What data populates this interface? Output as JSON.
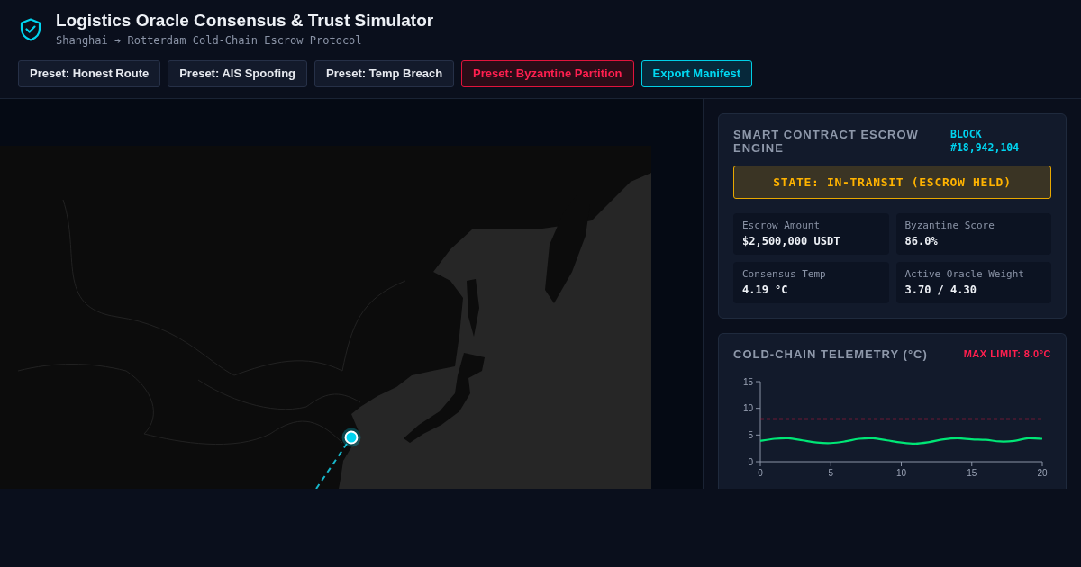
{
  "header": {
    "title": "Logistics Oracle Consensus & Trust Simulator",
    "subtitle": "Shanghai ➔ Rotterdam Cold-Chain Escrow Protocol"
  },
  "toolbar": {
    "buttons": [
      {
        "label": "Preset: Honest Route",
        "kind": "preset"
      },
      {
        "label": "Preset: AIS Spoofing",
        "kind": "preset"
      },
      {
        "label": "Preset: Temp Breach",
        "kind": "preset"
      },
      {
        "label": "Preset: Byzantine Partition",
        "kind": "danger"
      },
      {
        "label": "Export Manifest",
        "kind": "export"
      }
    ]
  },
  "escrow_panel": {
    "title": "SMART CONTRACT ESCROW ENGINE",
    "block": "BLOCK #18,942,104",
    "state": {
      "label": "STATE: IN-TRANSIT (ESCROW HELD)",
      "kind": "held"
    },
    "metrics": [
      {
        "label": "Escrow Amount",
        "value": "$2,500,000 USDT"
      },
      {
        "label": "Byzantine Score",
        "value": "86.0%"
      },
      {
        "label": "Consensus Temp",
        "value": "4.19 °C"
      },
      {
        "label": "Active Oracle Weight",
        "value": "3.70 / 4.30"
      }
    ]
  },
  "telemetry_panel": {
    "title": "COLD-CHAIN TELEMETRY (°C)",
    "limit_label": "MAX LIMIT: 8.0°C",
    "chart_data": {
      "type": "line",
      "x": [
        0,
        1,
        2,
        3,
        4,
        5,
        6,
        7,
        8,
        9,
        10,
        11,
        12,
        13,
        14,
        15,
        16,
        17,
        18,
        19,
        20
      ],
      "series": [
        {
          "color": "#00e676",
          "values": [
            3.9,
            4.3,
            4.4,
            4.0,
            3.6,
            3.5,
            3.8,
            4.3,
            4.4,
            4.0,
            3.6,
            3.4,
            3.7,
            4.2,
            4.4,
            4.2,
            4.1,
            3.8,
            3.9,
            4.4,
            4.3
          ]
        }
      ],
      "xlim": [
        0,
        20
      ],
      "ylim": [
        0,
        15
      ],
      "xticks": [
        0,
        5,
        10,
        15,
        20
      ],
      "yticks": [
        0,
        5,
        10,
        15
      ],
      "ref_lines": [
        {
          "axis": "y",
          "value": 8
        }
      ]
    }
  }
}
